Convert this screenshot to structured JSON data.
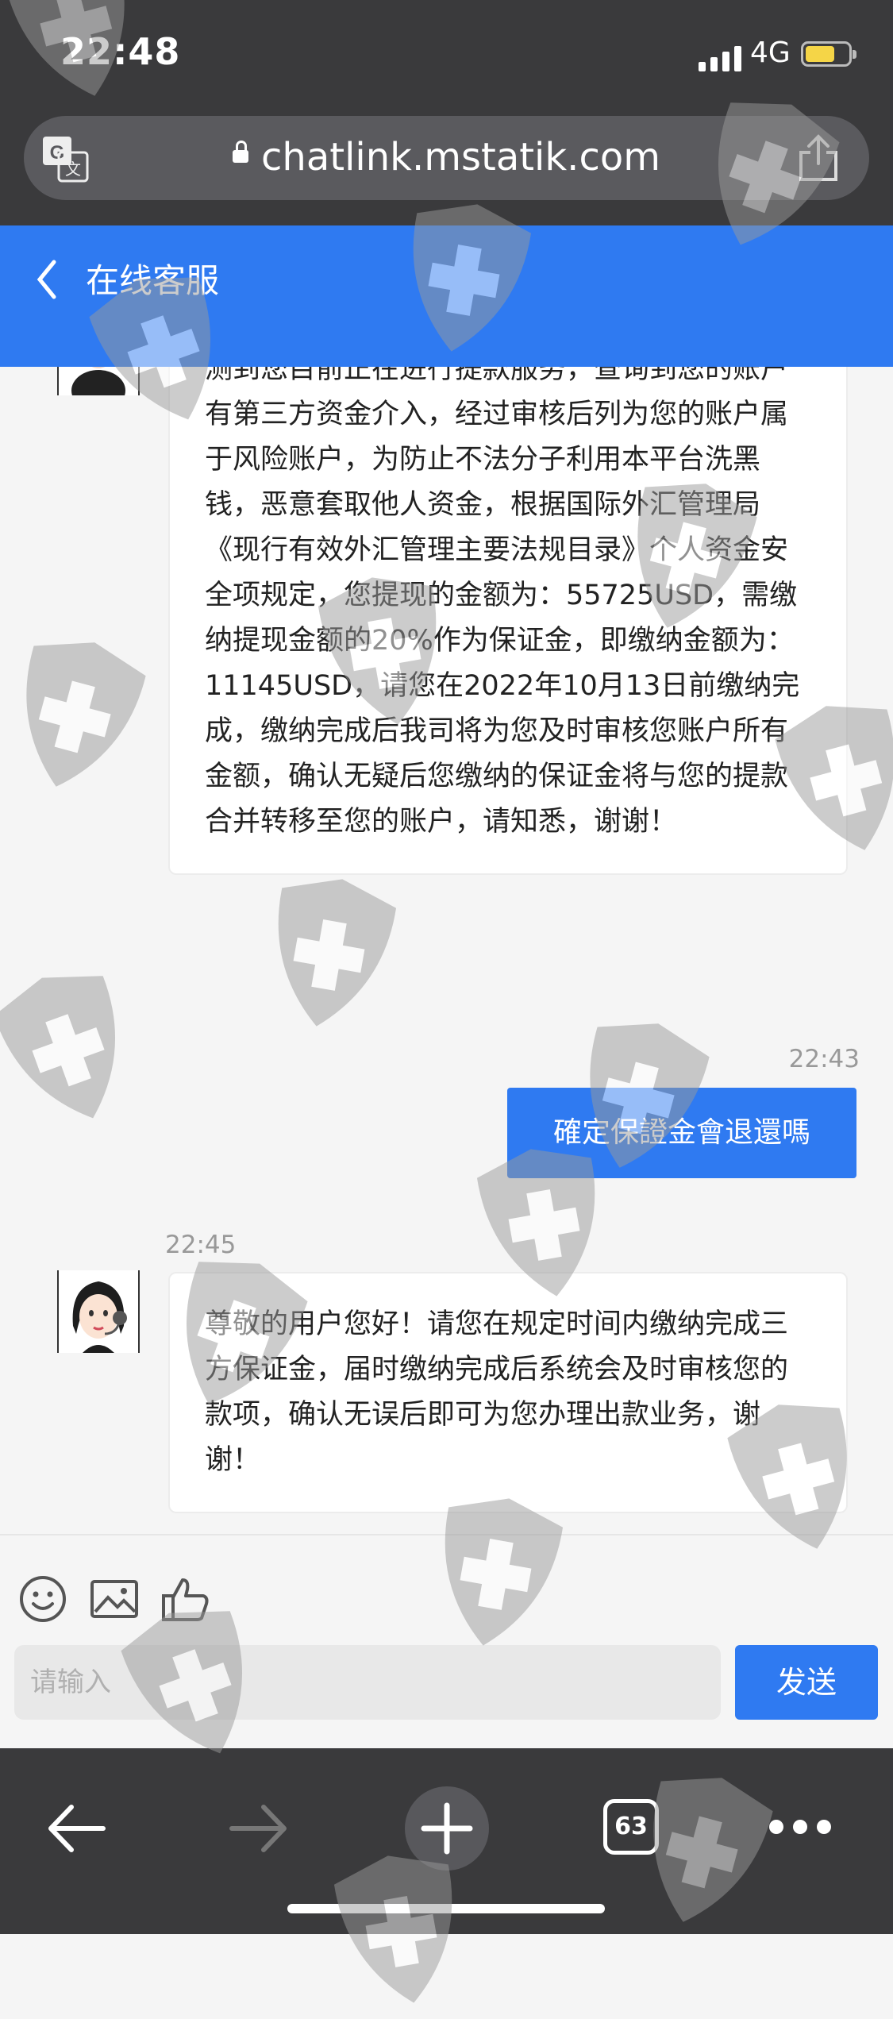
{
  "status_bar": {
    "time": "22:48",
    "network": "4G"
  },
  "browser": {
    "url": "chatlink.mstatik.com",
    "tab_count": "63"
  },
  "header": {
    "title": "在线客服"
  },
  "messages": [
    {
      "direction": "incoming",
      "text": "尊敬的用户您好，经工级风控部门通知：系统检测到您目前正在进行提款服务，查询到您的账户有第三方资金介入，经过审核后列为您的账户属于风险账户，为防止不法分子利用本平台洗黑钱，恶意套取他人资金，根据国际外汇管理局《现行有效外汇管理主要法规目录》个人资金安全项规定，您提现的金额为：55725USD，需缴纳提现金额的20%作为保证金，即缴纳金额为：11145USD，请您在2022年10月13日前缴纳完成，缴纳完成后我司将为您及时审核您账户所有金额，确认无疑后您缴纳的保证金将与您的提款合并转移至您的账户，请知悉，谢谢！"
    },
    {
      "direction": "outgoing",
      "time": "22:43",
      "text": "確定保證金會退還嗎"
    },
    {
      "direction": "incoming",
      "time": "22:45",
      "text": "尊敬的用户您好！请您在规定时间内缴纳完成三方保证金，届时缴纳完成后系统会及时审核您的款项，确认无误后即可为您办理出款业务，谢谢！"
    }
  ],
  "composer": {
    "placeholder": "请输入",
    "send_label": "发送"
  },
  "icons": [
    "translate-icon",
    "lock-icon",
    "share-icon",
    "chevron-left-icon",
    "smiley-icon",
    "image-icon",
    "thumbs-up-icon",
    "back-arrow-icon",
    "forward-arrow-icon",
    "plus-icon",
    "more-icon"
  ],
  "colors": {
    "accent": "#2f7af1",
    "chrome": "#3a3a3c",
    "background": "#f5f5f5"
  }
}
